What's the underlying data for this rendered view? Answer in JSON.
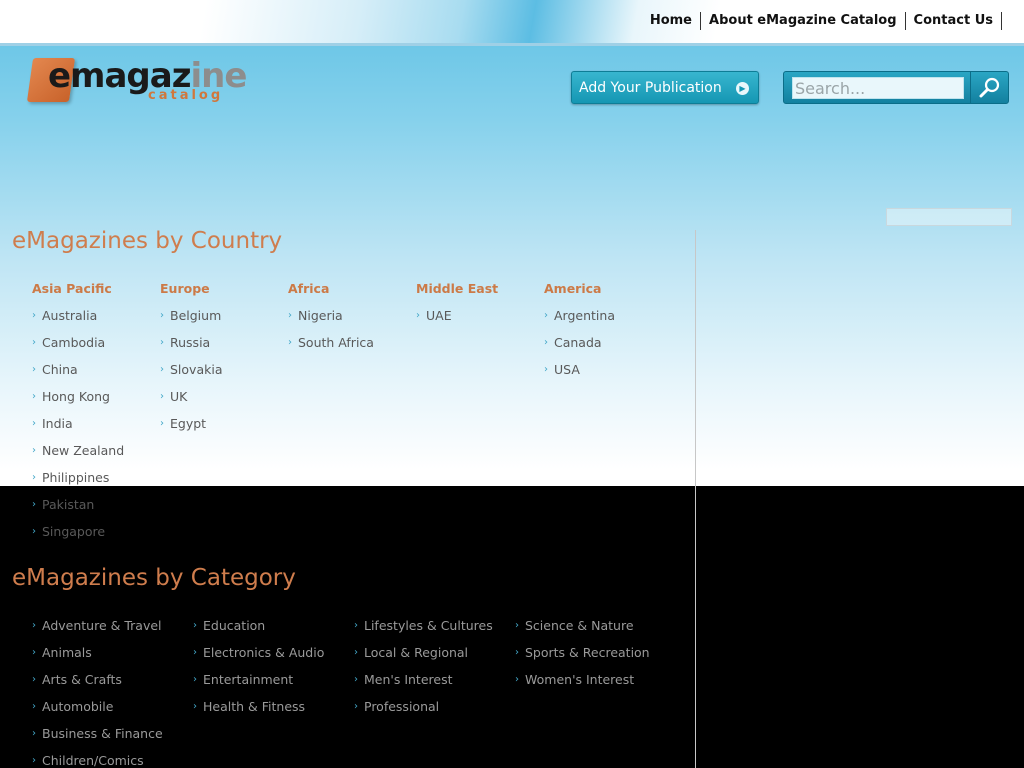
{
  "topnav": [
    "Home",
    "About eMagazine Catalog",
    "Contact Us"
  ],
  "logo": {
    "word_main": "emagaz",
    "word_fade": "ine",
    "word_sub": "catalog"
  },
  "add_publication": "Add Your Publication",
  "search": {
    "placeholder": "Search..."
  },
  "country": {
    "title": "eMagazines by Country",
    "regions": [
      {
        "name": "Asia Pacific",
        "items": [
          "Australia",
          "Cambodia",
          "China",
          "Hong Kong",
          "India",
          "New Zealand",
          "Philippines",
          "Pakistan",
          "Singapore"
        ]
      },
      {
        "name": "Europe",
        "items": [
          "Belgium",
          "Russia",
          "Slovakia",
          "UK",
          "Egypt"
        ]
      },
      {
        "name": "Africa",
        "items": [
          "Nigeria",
          "South Africa"
        ]
      },
      {
        "name": "Middle East",
        "items": [
          "UAE"
        ]
      },
      {
        "name": "America",
        "items": [
          "Argentina",
          "Canada",
          "USA"
        ]
      }
    ]
  },
  "category": {
    "title": "eMagazines by Category",
    "columns": [
      [
        "Adventure & Travel",
        "Animals",
        "Arts & Crafts",
        "Automobile",
        "Business & Finance",
        "Children/Comics"
      ],
      [
        "Education",
        "Electronics & Audio",
        "Entertainment",
        "Health & Fitness"
      ],
      [
        "Lifestyles & Cultures",
        "Local & Regional",
        "Men's Interest",
        "Professional"
      ],
      [
        "Science & Nature",
        "Sports & Recreation",
        "Women's Interest"
      ]
    ]
  },
  "colors": {
    "accent": "#cf7d4d",
    "link": "#595959",
    "button": "#1597b3"
  }
}
